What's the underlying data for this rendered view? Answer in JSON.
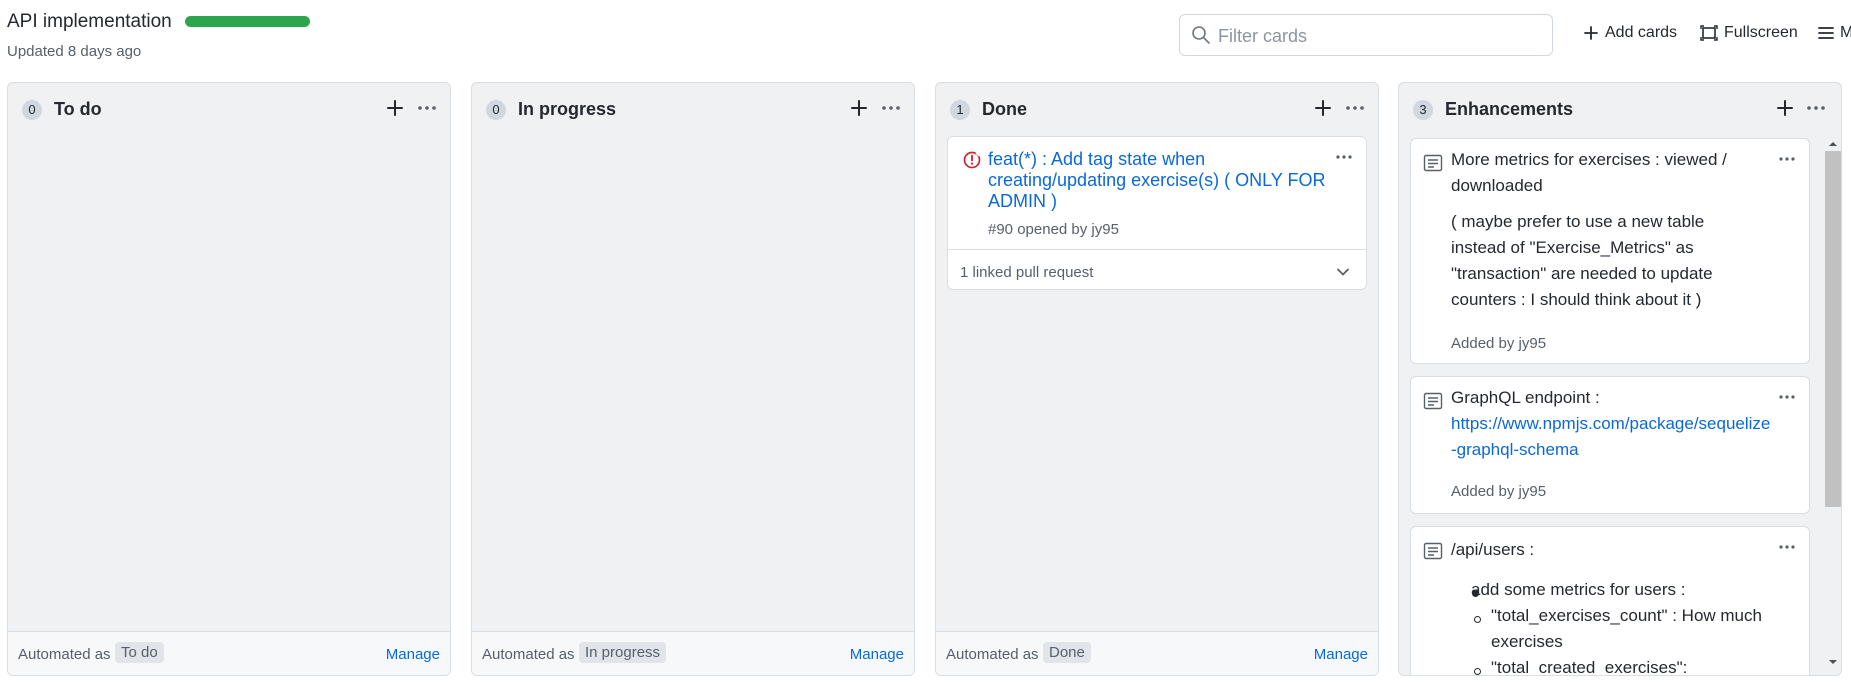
{
  "header": {
    "title": "API implementation",
    "updated": "Updated 8 days ago",
    "filter_placeholder": "Filter cards",
    "add_cards": "Add cards",
    "fullscreen": "Fullscreen",
    "menu": "M",
    "progress_percent": 100,
    "progress_color": "#2da44e"
  },
  "columns": [
    {
      "count": "0",
      "name": "To do",
      "automated_label": "Automated as",
      "automated_value": "To do",
      "manage": "Manage"
    },
    {
      "count": "0",
      "name": "In progress",
      "automated_label": "Automated as",
      "automated_value": "In progress",
      "manage": "Manage"
    },
    {
      "count": "1",
      "name": "Done",
      "automated_label": "Automated as",
      "automated_value": "Done",
      "manage": "Manage"
    },
    {
      "count": "3",
      "name": "Enhancements"
    }
  ],
  "done_card": {
    "title": "feat(*) : Add tag state when creating/updating exercise(s) ( ONLY FOR ADMIN )",
    "meta": "#90 opened by jy95",
    "linked": "1 linked pull request",
    "icon": "issue-closed-icon",
    "icon_color": "#cf222e"
  },
  "notes": [
    {
      "title": "More metrics for exercises : viewed / downloaded",
      "body": "( maybe prefer to use a new table instead of \"Exercise_Metrics\" as \"transaction\" are needed to update counters : I should think about it )",
      "added": "Added by jy95"
    },
    {
      "title": "GraphQL endpoint :",
      "link": "https://www.npmjs.com/package/sequelize-graphql-schema",
      "added": "Added by jy95"
    },
    {
      "title": "/api/users :",
      "bullet1": "add some metrics for users :",
      "sub1": "\"total_exercises_count\" : How much exercises",
      "sub2": "\"total_created_exercises\":"
    }
  ]
}
